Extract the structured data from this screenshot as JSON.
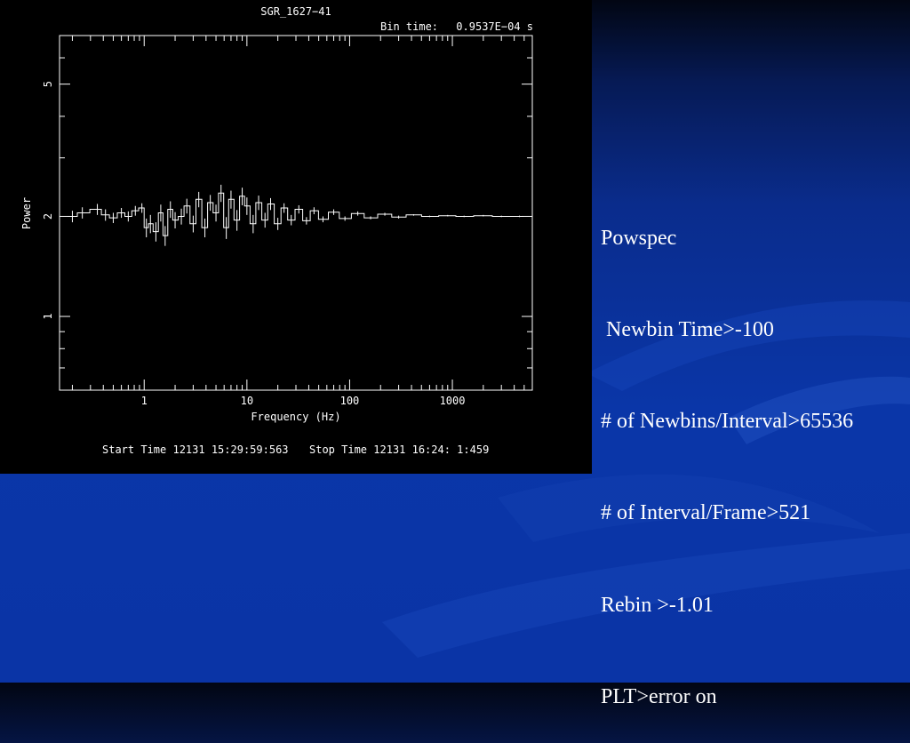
{
  "slide": {
    "notes": [
      "Powspec",
      " Newbin Time>-100",
      "# of Newbins/Interval>65536",
      "# of Interval/Frame>521",
      "Rebin >-1.01",
      "PLT>error on"
    ]
  },
  "chart_data": {
    "type": "line",
    "title": "SGR_1627−41",
    "bin_time_label": "Bin time:",
    "bin_time_value": "0.9537E−04 s",
    "xlabel": "Frequency (Hz)",
    "ylabel": "Power",
    "x_scale": "log",
    "y_scale": "log",
    "xlim": [
      0.15,
      6000
    ],
    "ylim": [
      0.6,
      7.0
    ],
    "xticks": [
      {
        "value": 1,
        "label": "1"
      },
      {
        "value": 10,
        "label": "10"
      },
      {
        "value": 100,
        "label": "100"
      },
      {
        "value": 1000,
        "label": "1000"
      }
    ],
    "yticks": [
      {
        "value": 1,
        "label": "1"
      },
      {
        "value": 2,
        "label": "2"
      },
      {
        "value": 5,
        "label": "5"
      }
    ],
    "start_time": "Start Time 12131 15:29:59:563",
    "stop_time": "Stop Time 12131 16:24: 1:459",
    "series": [
      {
        "style": "step-with-errors",
        "x": [
          0.2,
          0.25,
          0.35,
          0.42,
          0.5,
          0.6,
          0.7,
          0.82,
          0.95,
          1.05,
          1.15,
          1.3,
          1.45,
          1.6,
          1.8,
          2.0,
          2.3,
          2.6,
          3.0,
          3.4,
          3.9,
          4.4,
          5.0,
          5.6,
          6.3,
          7.0,
          8.0,
          9.0,
          10.0,
          11.5,
          13,
          15,
          17,
          20,
          23,
          27,
          32,
          38,
          45,
          55,
          70,
          90,
          120,
          160,
          220,
          300,
          420,
          600,
          900,
          1300,
          2000,
          3000,
          4500
        ],
        "y": [
          2.0,
          2.05,
          2.1,
          2.02,
          1.98,
          2.05,
          2.0,
          2.08,
          2.12,
          1.85,
          1.9,
          1.8,
          2.05,
          1.75,
          2.1,
          1.95,
          2.0,
          2.15,
          1.9,
          2.25,
          1.85,
          2.2,
          2.05,
          2.35,
          1.85,
          2.25,
          1.95,
          2.3,
          2.15,
          1.9,
          2.2,
          1.95,
          2.18,
          1.9,
          2.12,
          1.95,
          2.1,
          1.94,
          2.08,
          1.96,
          2.06,
          1.97,
          2.04,
          1.98,
          2.03,
          1.99,
          2.02,
          2.0,
          2.01,
          2.0,
          2.01,
          2.0,
          2.0
        ],
        "err": [
          0.08,
          0.08,
          0.08,
          0.08,
          0.07,
          0.07,
          0.07,
          0.07,
          0.07,
          0.12,
          0.12,
          0.12,
          0.12,
          0.12,
          0.12,
          0.11,
          0.11,
          0.11,
          0.11,
          0.12,
          0.12,
          0.12,
          0.12,
          0.14,
          0.14,
          0.14,
          0.14,
          0.14,
          0.13,
          0.12,
          0.11,
          0.1,
          0.09,
          0.08,
          0.07,
          0.07,
          0.06,
          0.05,
          0.05,
          0.04,
          0.04,
          0.03,
          0.03,
          0.02,
          0.02,
          0.02,
          0.01,
          0.01,
          0.01,
          0.01,
          0.01,
          0.01,
          0.01
        ]
      }
    ]
  }
}
